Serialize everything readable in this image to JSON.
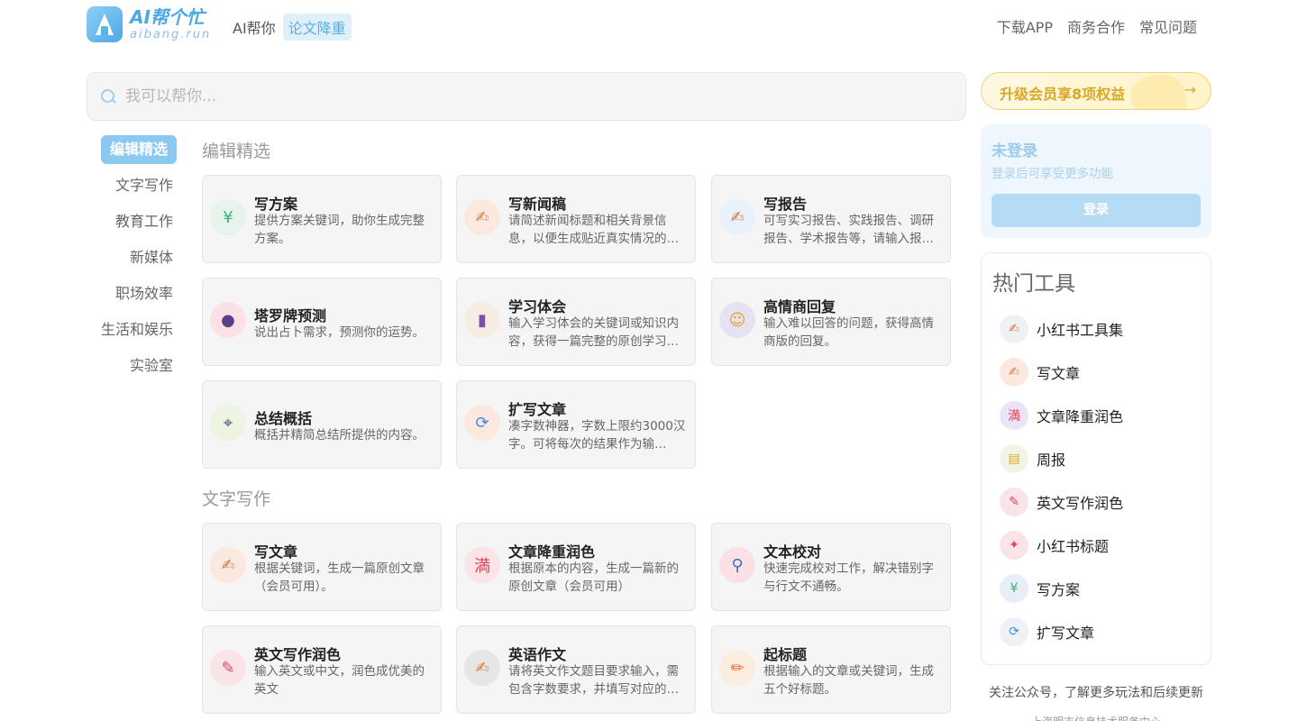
{
  "header": {
    "logo_cn": "AI帮个忙",
    "logo_en": "aibang.run",
    "nav_left": [
      "AI帮你",
      "论文降重"
    ],
    "nav_right": [
      "下载APP",
      "商务合作",
      "常见问题"
    ]
  },
  "search": {
    "placeholder": "我可以帮你..."
  },
  "categories": [
    "编辑精选",
    "文字写作",
    "教育工作",
    "新媒体",
    "职场效率",
    "生活和娱乐",
    "实验室"
  ],
  "sections": [
    {
      "title": "编辑精选",
      "cards": [
        {
          "title": "写方案",
          "desc": "提供方案关键词，助你生成完整方案。",
          "icon": "plan-icon",
          "glyph": "¥",
          "color": "#3bb273",
          "bg": "#e6f4ec"
        },
        {
          "title": "写新闻稿",
          "desc": "请简述新闻标题和相关背景信息，以便生成贴近真实情况的…",
          "icon": "writing-hand-icon",
          "glyph": "✍",
          "color": "#d67a4a",
          "bg": "#fbe9df"
        },
        {
          "title": "写报告",
          "desc": "可写实习报告、实践报告、调研报告、学术报告等，请输入报…",
          "icon": "writing-hand-icon",
          "glyph": "✍",
          "color": "#d67a4a",
          "bg": "#e8f2fa"
        },
        {
          "title": "塔罗牌预测",
          "desc": "说出占卜需求，预测你的运势。",
          "icon": "crystal-ball-icon",
          "glyph": "●",
          "color": "#5a3f8a",
          "bg": "#fbe1e6"
        },
        {
          "title": "学习体会",
          "desc": "输入学习体会的关键词或知识内容，获得一篇完整的原创学习…",
          "icon": "books-icon",
          "glyph": "▮",
          "color": "#7b4fb0",
          "bg": "#f7ece2"
        },
        {
          "title": "高情商回复",
          "desc": "输入难以回答的问题，获得高情商版的回复。",
          "icon": "smile-icon",
          "glyph": "☺",
          "color": "#e3a21a",
          "bg": "#e6e1f4"
        },
        {
          "title": "总结概括",
          "desc": "概括并精简总结所提供的内容。",
          "icon": "telescope-icon",
          "glyph": "⌖",
          "color": "#555577",
          "bg": "#eef4e2"
        },
        {
          "title": "扩写文章",
          "desc": "凑字数神器，字数上限约3000汉字。可将每次的结果作为输…",
          "icon": "refresh-icon",
          "glyph": "⟳",
          "color": "#3d8fe0",
          "bg": "#fbe9df"
        }
      ]
    },
    {
      "title": "文字写作",
      "cards": [
        {
          "title": "写文章",
          "desc": "根据关键词，生成一篇原创文章（会员可用）。",
          "icon": "writing-hand-icon",
          "glyph": "✍",
          "color": "#d67a4a",
          "bg": "#fbe9df"
        },
        {
          "title": "文章降重润色",
          "desc": "根据原本的内容，生成一篇新的原创文章（会员可用）",
          "icon": "full-badge-icon",
          "glyph": "満",
          "color": "#e0445c",
          "bg": "#fbe4e8"
        },
        {
          "title": "文本校对",
          "desc": "快速完成校对工作，解决错别字与行文不通畅。",
          "icon": "magnifier-icon",
          "glyph": "⚲",
          "color": "#3d6fc0",
          "bg": "#fbe1e6"
        },
        {
          "title": "英文写作润色",
          "desc": "输入英文或中文，润色成优美的英文",
          "icon": "pen-icon",
          "glyph": "✎",
          "color": "#e0445c",
          "bg": "#fbe4e8"
        },
        {
          "title": "英语作文",
          "desc": "请将英文作文题目要求输入，需包含字数要求，并填写对应的…",
          "icon": "writing-hand-icon",
          "glyph": "✍",
          "color": "#d67a4a",
          "bg": "#e6e6e6"
        },
        {
          "title": "起标题",
          "desc": "根据输入的文章或关键词，生成五个好标题。",
          "icon": "pencil-icon",
          "glyph": "✏",
          "color": "#e66a2e",
          "bg": "#fbeee0"
        }
      ]
    }
  ],
  "sidebar": {
    "vip_label": "升级会员享8项权益",
    "vip_arrow": "→",
    "login_title": "未登录",
    "login_sub": "登录后可享受更多功能",
    "login_button": "登录",
    "hot_title": "热门工具",
    "hot_tools": [
      {
        "label": "小红书工具集",
        "icon": "writing-hand-icon",
        "glyph": "✍",
        "color": "#d67a4a",
        "bg": "#eef2f7"
      },
      {
        "label": "写文章",
        "icon": "writing-hand-icon",
        "glyph": "✍",
        "color": "#d67a4a",
        "bg": "#fbe9df"
      },
      {
        "label": "文章降重润色",
        "icon": "full-badge-icon",
        "glyph": "満",
        "color": "#e0445c",
        "bg": "#ece4f6"
      },
      {
        "label": "周报",
        "icon": "scroll-icon",
        "glyph": "▤",
        "color": "#d9a827",
        "bg": "#f4f4e6"
      },
      {
        "label": "英文写作润色",
        "icon": "pen-icon",
        "glyph": "✎",
        "color": "#e0445c",
        "bg": "#fbe4e8"
      },
      {
        "label": "小红书标题",
        "icon": "pushpin-icon",
        "glyph": "✦",
        "color": "#e0445c",
        "bg": "#fbe4e8"
      },
      {
        "label": "写方案",
        "icon": "plan-icon",
        "glyph": "¥",
        "color": "#3bb273",
        "bg": "#e8eef7"
      },
      {
        "label": "扩写文章",
        "icon": "refresh-icon",
        "glyph": "⟳",
        "color": "#3d8fe0",
        "bg": "#eef2f7"
      }
    ],
    "follow_text": "关注公众号，了解更多玩法和后续更新",
    "company_text": "上海明志信息技术服务中心"
  }
}
